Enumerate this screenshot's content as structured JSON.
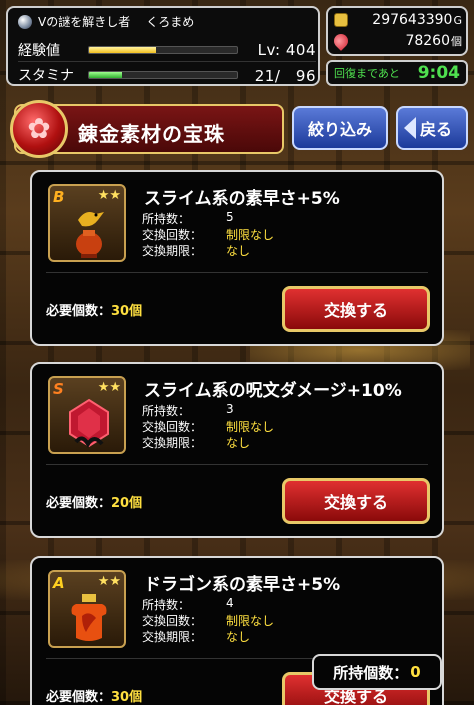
{
  "status": {
    "title": "Vの謎を解きし者",
    "player": "くろまめ",
    "exp_label": "経験値",
    "exp_progress": 0.45,
    "level": "Lv: 404",
    "stamina_label": "スタミナ",
    "stamina_progress": 0.22,
    "stamina_value": "21/　96"
  },
  "currency": {
    "gold": "297643390",
    "gold_unit": "G",
    "gems": "78260",
    "gem_unit": "個",
    "recover_label": "回復まであと",
    "recover_time": "9:04"
  },
  "header": {
    "title": "錬金素材の宝珠",
    "filter_label": "絞り込み",
    "back_label": "戻る"
  },
  "items": [
    {
      "rank": "B",
      "stars": "★★",
      "name": "スライム系の素早さ+5%",
      "owned_label": "所持数：",
      "owned_value": "5",
      "count_label": "交換回数：",
      "count_value": "制限なし",
      "period_label": "交換期限：",
      "period_value": "なし",
      "need_label": "必要個数：",
      "need_value": "30個",
      "button_label": "交換する"
    },
    {
      "rank": "S",
      "stars": "★★",
      "name": "スライム系の呪文ダメージ+10%",
      "owned_label": "所持数：",
      "owned_value": "3",
      "count_label": "交換回数：",
      "count_value": "制限なし",
      "period_label": "交換期限：",
      "period_value": "なし",
      "need_label": "必要個数：",
      "need_value": "20個",
      "button_label": "交換する"
    },
    {
      "rank": "A",
      "stars": "★★",
      "name": "ドラゴン系の素早さ+5%",
      "owned_label": "所持数：",
      "owned_value": "4",
      "count_label": "交換回数：",
      "count_value": "制限なし",
      "period_label": "交換期限：",
      "period_value": "なし",
      "need_label": "必要個数：",
      "need_value": "30個",
      "button_label": "交換する"
    }
  ],
  "footer": {
    "owned_label": "所持個数：",
    "owned_value": "0"
  },
  "colors": {
    "accent_gold": "#e8c868",
    "highlight_yellow": "#ffe040",
    "recover_green": "#4fe04f",
    "exchange_red": "#c01818",
    "nav_blue": "#2a4ab0"
  }
}
